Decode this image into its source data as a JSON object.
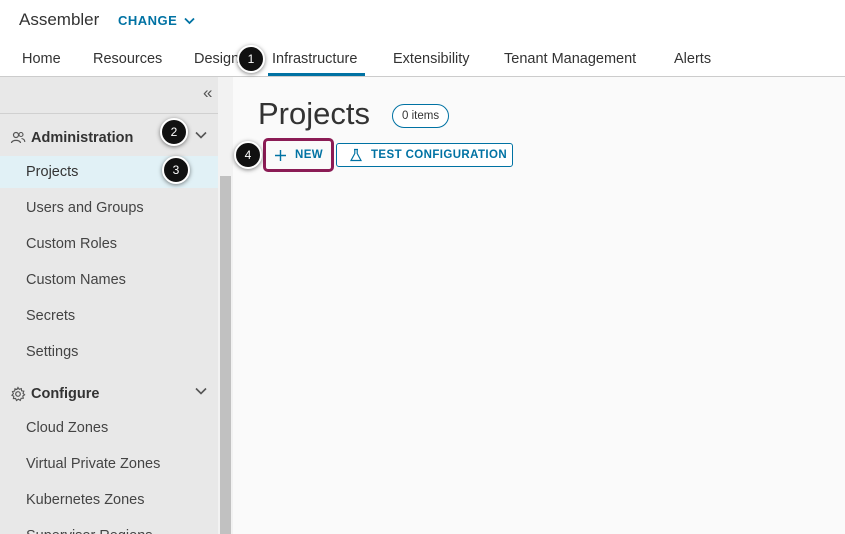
{
  "header": {
    "app_title": "Assembler",
    "change_label": "CHANGE"
  },
  "nav": {
    "tabs": [
      {
        "label": "Home"
      },
      {
        "label": "Resources"
      },
      {
        "label": "Design"
      },
      {
        "label": "Infrastructure",
        "active": true
      },
      {
        "label": "Extensibility"
      },
      {
        "label": "Tenant Management"
      },
      {
        "label": "Alerts"
      }
    ]
  },
  "sidebar": {
    "collapse_glyph": "«",
    "groups": [
      {
        "label": "Administration",
        "icon": "users-icon",
        "items": [
          {
            "label": "Projects",
            "selected": true
          },
          {
            "label": "Users and Groups"
          },
          {
            "label": "Custom Roles"
          },
          {
            "label": "Custom Names"
          },
          {
            "label": "Secrets"
          },
          {
            "label": "Settings"
          }
        ]
      },
      {
        "label": "Configure",
        "icon": "gear-icon",
        "items": [
          {
            "label": "Cloud Zones"
          },
          {
            "label": "Virtual Private Zones"
          },
          {
            "label": "Kubernetes Zones"
          },
          {
            "label": "Supervisor Regions"
          }
        ]
      }
    ]
  },
  "main": {
    "title": "Projects",
    "count_badge": "0 items",
    "new_button": "NEW",
    "test_button": "TEST CONFIGURATION"
  },
  "callouts": [
    "1",
    "2",
    "3",
    "4"
  ],
  "colors": {
    "accent": "#0072a3",
    "highlight": "#8b1c55",
    "selected_bg": "#e1f1f6"
  }
}
